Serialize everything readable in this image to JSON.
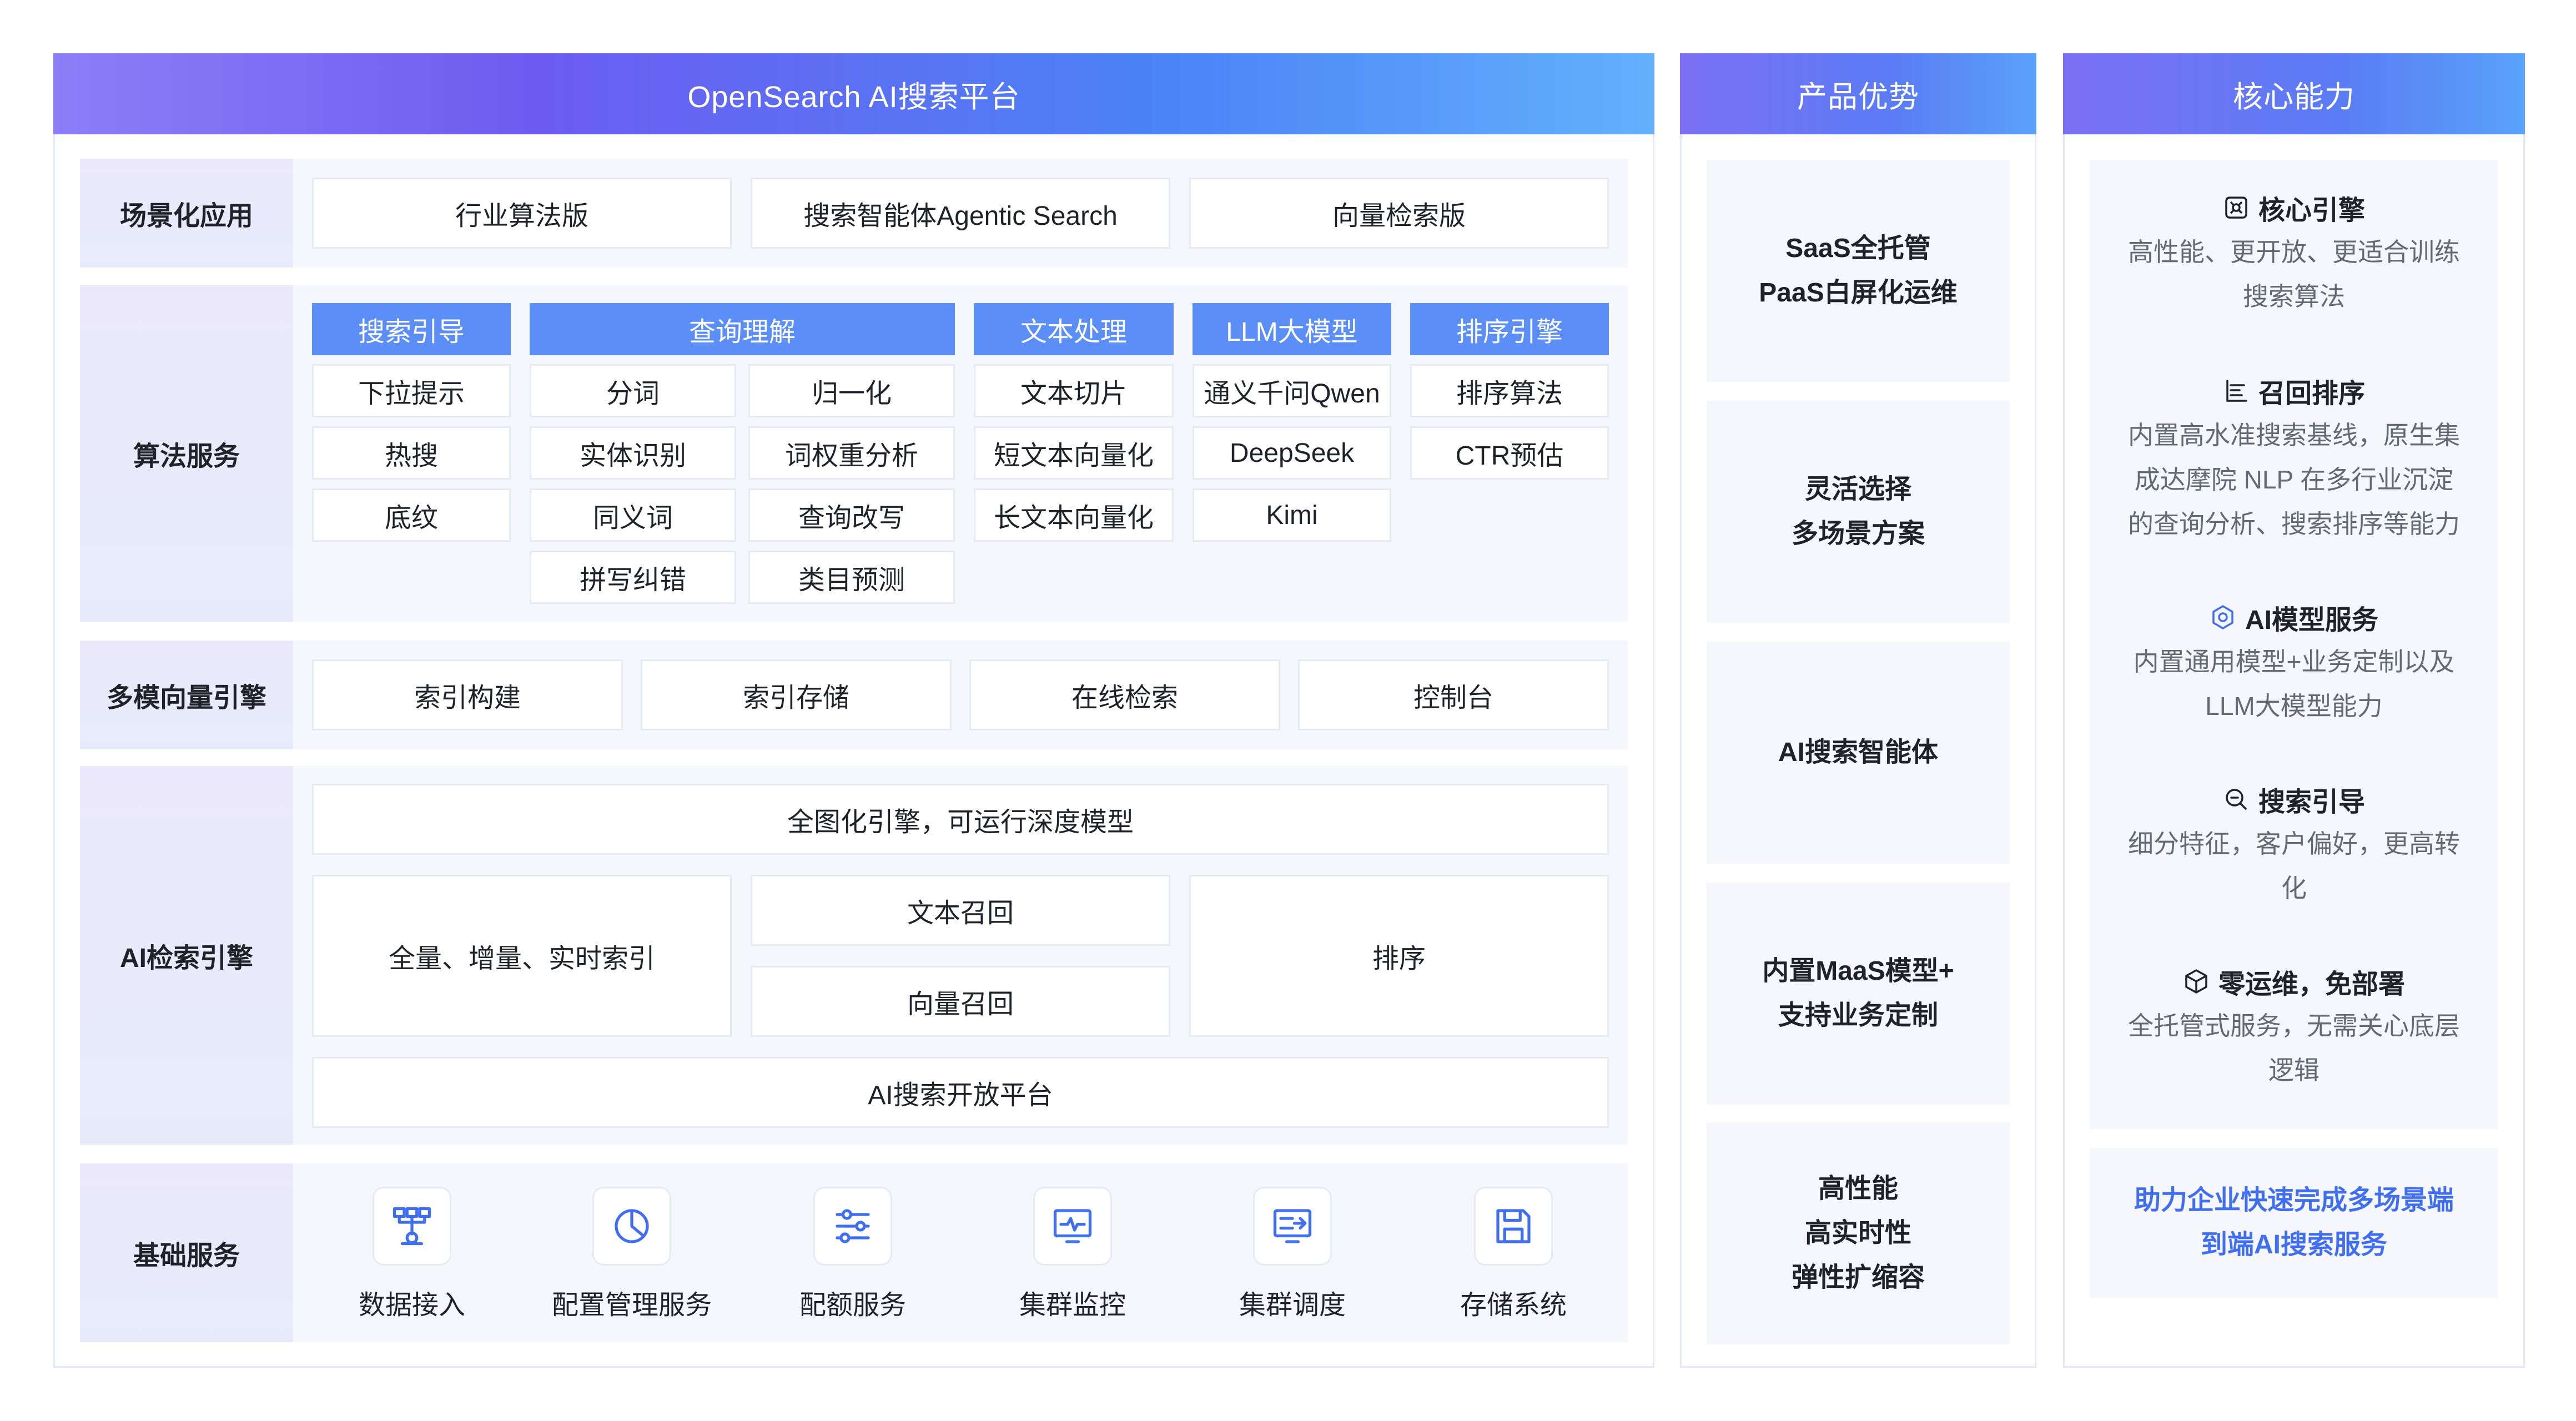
{
  "main": {
    "title": "OpenSearch AI搜索平台",
    "rows": {
      "scenario": {
        "label": "场景化应用",
        "items": [
          "行业算法版",
          "搜索智能体Agentic Search",
          "向量检索版"
        ]
      },
      "algorithm": {
        "label": "算法服务",
        "categories": {
          "search_guide": {
            "title": "搜索引导",
            "items": [
              "下拉提示",
              "热搜",
              "底纹"
            ]
          },
          "query_understanding": {
            "title": "查询理解",
            "items": [
              "分词",
              "归一化",
              "实体识别",
              "词权重分析",
              "同义词",
              "查询改写",
              "拼写纠错",
              "类目预测"
            ]
          },
          "text_processing": {
            "title": "文本处理",
            "items": [
              "文本切片",
              "短文本向量化",
              "长文本向量化"
            ]
          },
          "llm": {
            "title": "LLM大模型",
            "items": [
              "通义千问Qwen",
              "DeepSeek",
              "Kimi"
            ]
          },
          "ranking": {
            "title": "排序引擎",
            "items": [
              "排序算法",
              "CTR预估"
            ]
          }
        }
      },
      "vector": {
        "label": "多模向量引擎",
        "items": [
          "索引构建",
          "索引存储",
          "在线检索",
          "控制台"
        ]
      },
      "ai_engine": {
        "label": "AI检索引擎",
        "full_graph": "全图化引擎，可运行深度模型",
        "indexing": "全量、增量、实时索引",
        "text_recall": "文本召回",
        "vector_recall": "向量召回",
        "rank": "排序",
        "open_platform": "AI搜索开放平台"
      },
      "infra": {
        "label": "基础服务",
        "items": [
          {
            "label": "数据接入",
            "icon": "data-ingest-icon"
          },
          {
            "label": "配置管理服务",
            "icon": "pie-chart-icon"
          },
          {
            "label": "配额服务",
            "icon": "sliders-icon"
          },
          {
            "label": "集群监控",
            "icon": "monitor-pulse-icon"
          },
          {
            "label": "集群调度",
            "icon": "schedule-arrow-icon"
          },
          {
            "label": "存储系统",
            "icon": "save-disk-icon"
          }
        ]
      }
    }
  },
  "advantages": {
    "title": "产品优势",
    "cards": [
      {
        "line1": "SaaS全托管",
        "line2": "PaaS白屏化运维",
        "line3": ""
      },
      {
        "line1": "灵活选择",
        "line2": "多场景方案",
        "line3": ""
      },
      {
        "line1": "AI搜索智能体",
        "line2": "",
        "line3": ""
      },
      {
        "line1": "内置MaaS模型+",
        "line2": "支持业务定制",
        "line3": ""
      },
      {
        "line1": "高性能",
        "line2": "高实时性",
        "line3": "弹性扩缩容"
      }
    ]
  },
  "capabilities": {
    "title": "核心能力",
    "items": [
      {
        "title": "核心引擎",
        "icon": "engine-icon",
        "desc1": "高性能、更开放、更适合训练",
        "desc2": "搜索算法",
        "desc3": ""
      },
      {
        "title": "召回排序",
        "icon": "ranking-bars-icon",
        "desc1": "内置高水准搜索基线，原生集",
        "desc2": "成达摩院 NLP 在多行业沉淀",
        "desc3": "的查询分析、搜索排序等能力"
      },
      {
        "title": "AI模型服务",
        "icon": "ai-model-icon",
        "desc1": "内置通用模型+业务定制以及",
        "desc2": "LLM大模型能力",
        "desc3": ""
      },
      {
        "title": "搜索引导",
        "icon": "search-guide-icon",
        "desc1": "细分特征，客户偏好，更高转",
        "desc2": "化",
        "desc3": ""
      },
      {
        "title": "零运维，免部署",
        "icon": "cube-icon",
        "desc1": "全托管式服务，无需关心底层",
        "desc2": "逻辑",
        "desc3": ""
      }
    ],
    "footer_line1": "助力企业快速完成多场景端",
    "footer_line2": "到端AI搜索服务"
  },
  "colors": {
    "header_gradient_start": "#8b7ff7",
    "header_gradient_end": "#64b0fc",
    "category_blue": "#5b8ef6",
    "row_background": "#f5f7fd",
    "label_background": "#ece9fc",
    "footer_text": "#3f6ef1"
  }
}
